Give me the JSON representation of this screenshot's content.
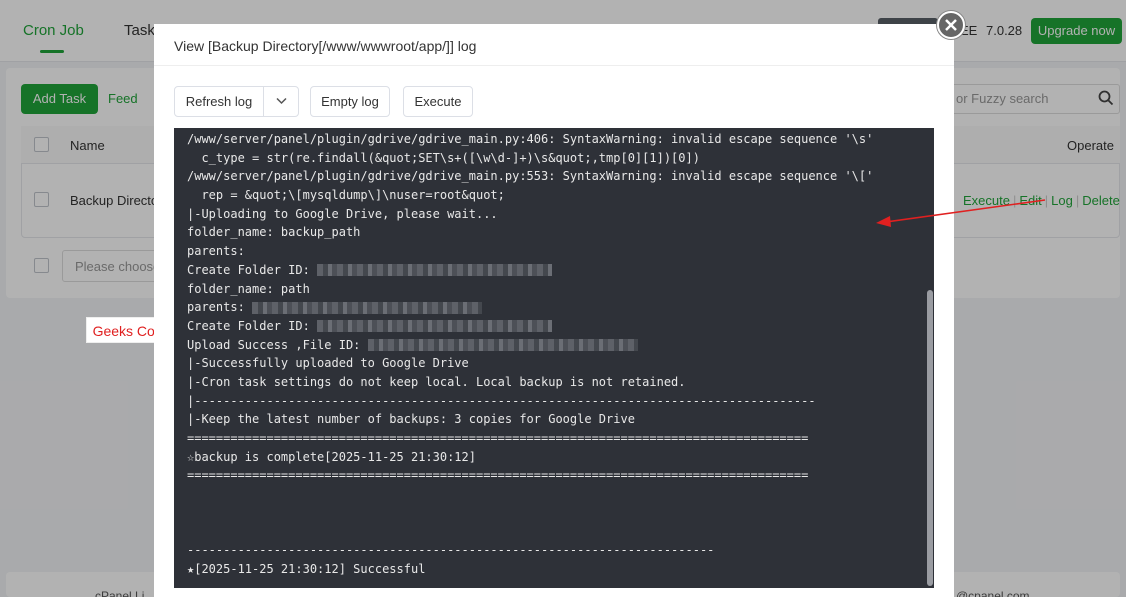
{
  "background": {
    "tabs": [
      {
        "label": "Cron Job",
        "active": true
      },
      {
        "label": "Task"
      }
    ],
    "edition_suffix": "EE",
    "version": "7.0.28",
    "upgrade_label": "Upgrade now",
    "add_task_label": "Add Task",
    "feedback_label": "Feed",
    "search_placeholder": "or Fuzzy search",
    "table": {
      "col_name": "Name",
      "col_operate": "Operate",
      "rows": [
        {
          "name": "Backup Directo",
          "actions": [
            "Execute",
            "Edit",
            "Log",
            "Delete"
          ]
        }
      ]
    },
    "batch_placeholder": "Please choose",
    "footer_left": "cPanel Li",
    "footer_right": "@cpanel.com"
  },
  "annotation_label": "Geeks Conn",
  "modal": {
    "title": "View [Backup Directory[/www/wwwroot/app/]] log",
    "toolbar": {
      "refresh_label": "Refresh log",
      "empty_label": "Empty log",
      "execute_label": "Execute"
    },
    "log": [
      {
        "text": "/www/server/panel/plugin/gdrive/gdrive_main.py:406: SyntaxWarning: invalid escape sequence '\\s'"
      },
      {
        "text": "  c_type = str(re.findall(&quot;SET\\s+([\\w\\d-]+)\\s&quot;,tmp[0][1])[0])"
      },
      {
        "text": "/www/server/panel/plugin/gdrive/gdrive_main.py:553: SyntaxWarning: invalid escape sequence '\\['"
      },
      {
        "text": "  rep = &quot;\\[mysqldump\\]\\nuser=root&quot;"
      },
      {
        "text": "|-Uploading to Google Drive, please wait..."
      },
      {
        "text": "folder_name: backup_path"
      },
      {
        "text": "parents:"
      },
      {
        "text": "Create Folder ID: ",
        "redacted": true
      },
      {
        "text": "folder_name: path"
      },
      {
        "text": "parents: ",
        "redacted": true
      },
      {
        "text": "Create Folder ID: ",
        "redacted": true
      },
      {
        "text": "Upload Success ,File ID: ",
        "redacted": true
      },
      {
        "text": "|-Successfully uploaded to Google Drive"
      },
      {
        "text": "|-Cron task settings do not keep local. Local backup is not retained."
      },
      {
        "text": "|--------------------------------------------------------------------------------------"
      },
      {
        "text": "|-Keep the latest number of backups: 3 copies for Google Drive"
      },
      {
        "text": "======================================================================================"
      },
      {
        "text": "☆backup is complete[2025-11-25 21:30:12]"
      },
      {
        "text": "======================================================================================"
      },
      {
        "text": ""
      },
      {
        "text": ""
      },
      {
        "text": ""
      },
      {
        "text": "-------------------------------------------------------------------------"
      },
      {
        "text": "★[2025-11-25 21:30:12] Successful"
      },
      {
        "text": "-------------------------------------------------------------------------"
      }
    ]
  },
  "colors": {
    "accent": "#20a53a",
    "log_bg": "#2e3138",
    "annotation": "#e02020"
  }
}
